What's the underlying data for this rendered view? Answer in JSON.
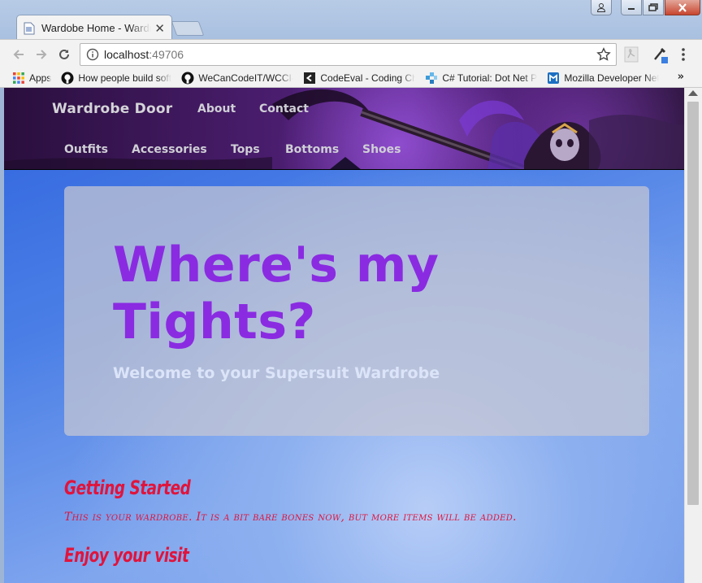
{
  "browser": {
    "tab_title": "Wardobe Home - Wardrobe Door",
    "url_host": "localhost",
    "url_port": ":49706"
  },
  "bookmarks": [
    {
      "label": "Apps",
      "icon": "apps-grid-icon"
    },
    {
      "label": "How people build software",
      "icon": "github-icon"
    },
    {
      "label": "WeCanCodeIT/WCCI-",
      "icon": "github-icon"
    },
    {
      "label": "CodeEval - Coding Challenges",
      "icon": "codeeval-icon"
    },
    {
      "label": "C# Tutorial: Dot Net Perls",
      "icon": "dotnetperls-icon"
    },
    {
      "label": "Mozilla Developer Network",
      "icon": "mdn-icon"
    }
  ],
  "site_nav": {
    "brand": "Wardrobe Door",
    "top_links": [
      "About",
      "Contact"
    ],
    "sub_links": [
      "Outfits",
      "Accessories",
      "Tops",
      "Bottoms",
      "Shoes"
    ]
  },
  "jumbotron": {
    "title": "Where's my Tights?",
    "subtitle": "Welcome to your Supersuit Wardrobe"
  },
  "sections": [
    {
      "heading": "Getting Started",
      "text": "This is your wardrobe. It is a bit bare bones now, but more items will be added."
    },
    {
      "heading": "Enjoy your visit",
      "text": ""
    }
  ],
  "colors": {
    "accent_purple": "#8a2be2",
    "heading_red": "#e0143c",
    "background_blue": "#4b7fe6"
  }
}
